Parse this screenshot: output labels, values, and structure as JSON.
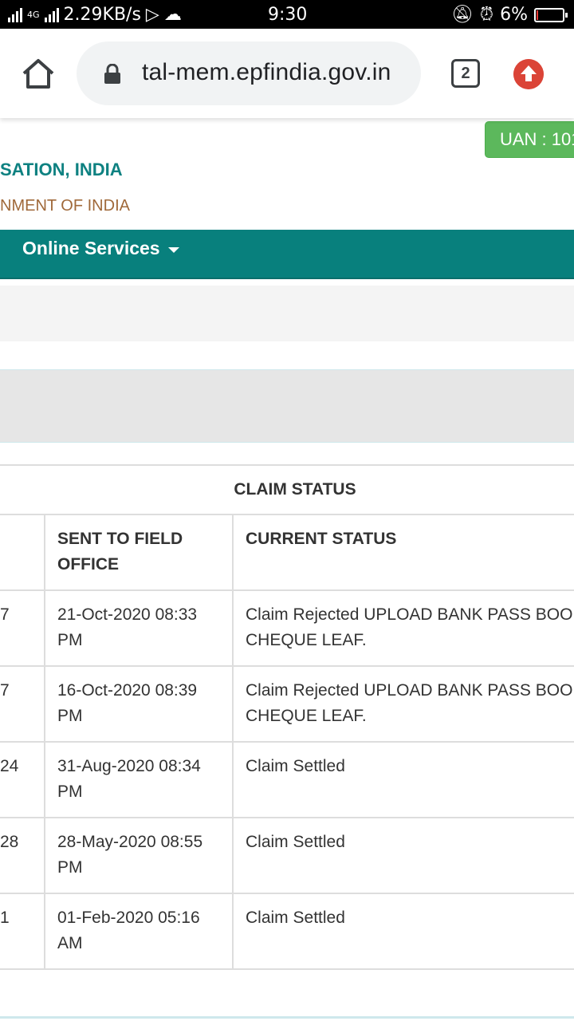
{
  "status_bar": {
    "net_label": "4G",
    "speed": "2.29KB/s",
    "time": "9:30",
    "battery": "6%",
    "battery_level": 0.06
  },
  "browser": {
    "url": "tal-mem.epfindia.gov.in",
    "tab_count": "2"
  },
  "header": {
    "uan_badge": "UAN : 101",
    "org_title": "SATION, INDIA",
    "org_subtitle": "NMENT OF INDIA",
    "nav_item": "Online Services"
  },
  "claim_table": {
    "caption": "CLAIM STATUS",
    "headers": {
      "col1": "",
      "col2_line1": "SENT TO FIELD",
      "col2_line2": "OFFICE",
      "col3": "CURRENT STATUS"
    },
    "rows": [
      {
        "c1": "7",
        "date": "21-Oct-2020 08:33",
        "ampm": "PM",
        "status_line1": "Claim Rejected UPLOAD BANK PASS BOO",
        "status_line2": "CHEQUE LEAF."
      },
      {
        "c1": "7",
        "date": "16-Oct-2020 08:39",
        "ampm": "PM",
        "status_line1": "Claim Rejected UPLOAD BANK PASS BOO",
        "status_line2": "CHEQUE LEAF."
      },
      {
        "c1": "24",
        "date": "31-Aug-2020 08:34",
        "ampm": "PM",
        "status_line1": "Claim Settled",
        "status_line2": ""
      },
      {
        "c1": "28",
        "date": "28-May-2020 08:55",
        "ampm": "PM",
        "status_line1": "Claim Settled",
        "status_line2": ""
      },
      {
        "c1": "1",
        "date": "01-Feb-2020 05:16",
        "ampm": "AM",
        "status_line1": "Claim Settled",
        "status_line2": ""
      }
    ]
  },
  "colors": {
    "teal_nav": "#08807d",
    "uan_green": "#5cb85c",
    "org_title": "#0e8181",
    "org_subtitle": "#a0693a"
  }
}
